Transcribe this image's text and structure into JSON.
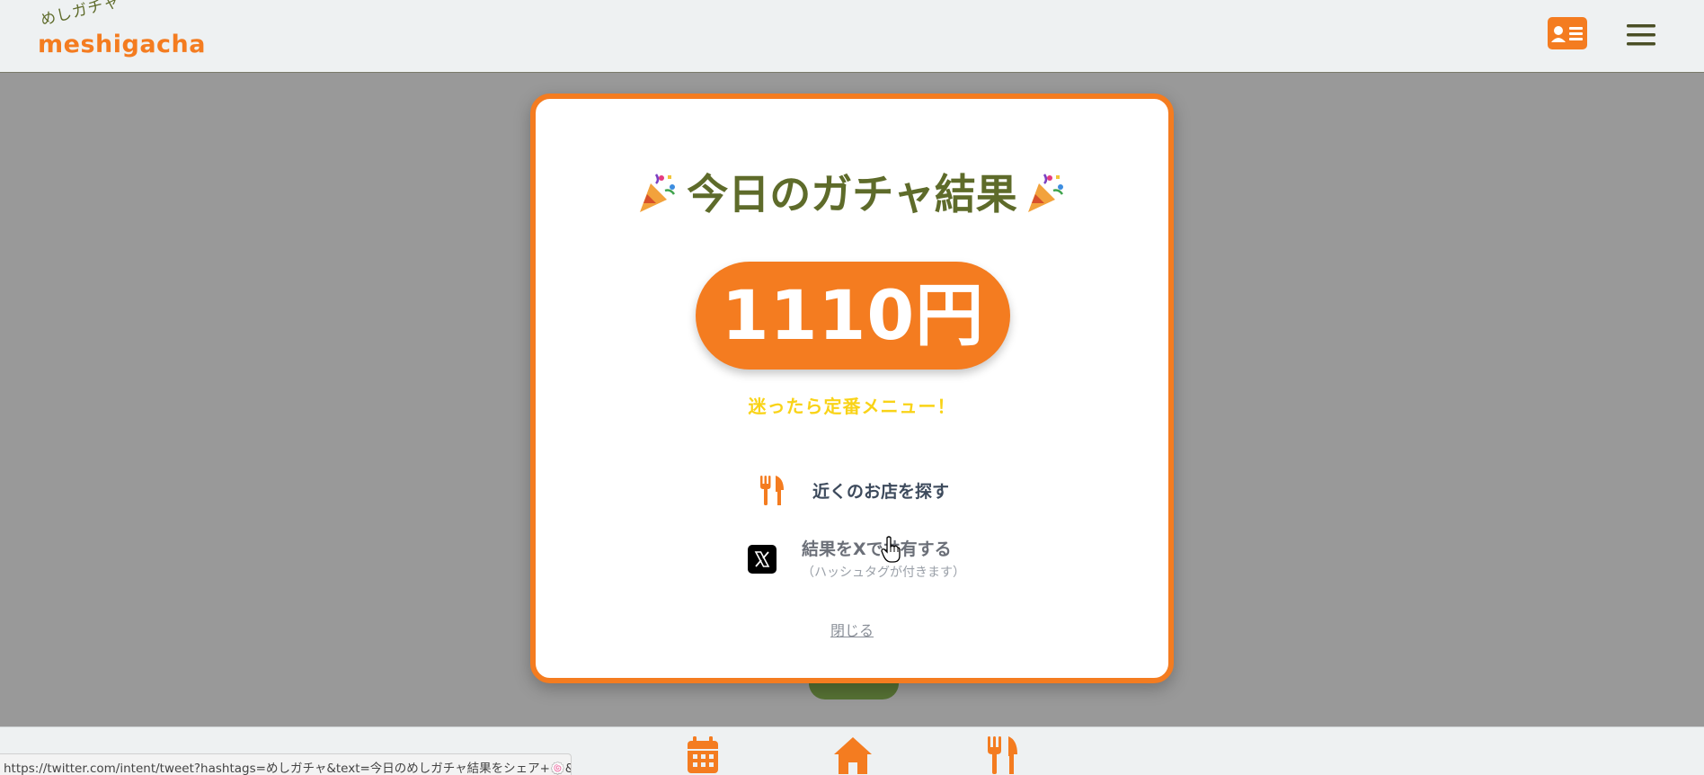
{
  "header": {
    "logo_sub": "めしガチャ",
    "logo_main": "meshigacha",
    "profile_icon": "id-card-icon",
    "menu_icon": "hamburger-menu-icon"
  },
  "modal": {
    "title": "今日のガチャ結果",
    "title_icon": "party-popper-icon",
    "price": "1110円",
    "tagline": "迷ったら定番メニュー！",
    "find_label": "近くのお店を探す",
    "find_icon": "fork-knife-icon",
    "share_label": "結果をXで共有する",
    "share_note": "（ハッシュタグが付きます）",
    "share_icon": "x-logo-icon",
    "close_label": "閉じる"
  },
  "bottom_nav": {
    "items": [
      {
        "icon": "calendar-icon"
      },
      {
        "icon": "home-icon"
      },
      {
        "icon": "fork-knife-icon"
      }
    ]
  },
  "status_bar": {
    "url": "https://twitter.com/intent/tweet?hashtags=めしガチャ&text=今日のめしガチャ結果をシェア+🍥&u..."
  },
  "colors": {
    "accent": "#f47c20",
    "title": "#5e6b2a",
    "tagline": "#f9d317",
    "overlay": "#999999"
  }
}
